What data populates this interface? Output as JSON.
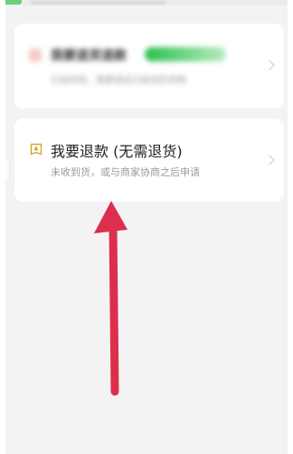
{
  "colors": {
    "arrow": "#dc2f4d",
    "badge_green": "#37c257",
    "icon_gold": "#d4a62a"
  },
  "options": [
    {
      "title": "我要退货退款",
      "badge": "",
      "subtitle": "已收到货，需要退还已收到的货物",
      "icon": "return-icon",
      "blurred": true
    },
    {
      "title": "我要退款 (无需退货)",
      "subtitle": "未收到货，或与商家协商之后申请",
      "icon": "refund-tag-icon",
      "blurred": false
    }
  ],
  "annotation": {
    "type": "arrow",
    "points_to": "options.1"
  }
}
